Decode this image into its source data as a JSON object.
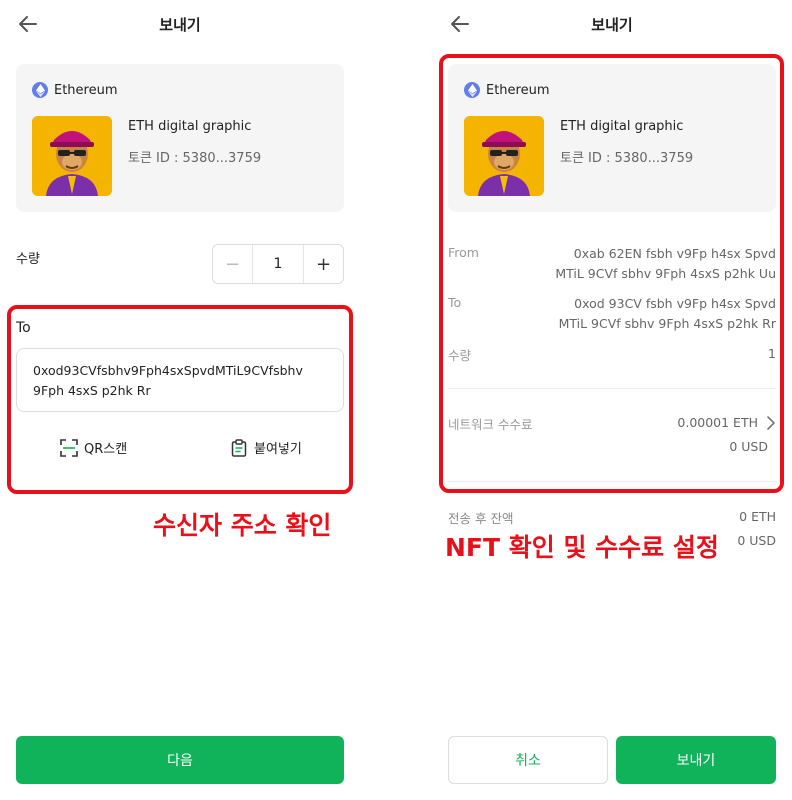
{
  "colors": {
    "accent": "#10b25a",
    "highlight": "#e8101a",
    "card_bg": "#f5f5f5",
    "eth": "#627eea"
  },
  "left": {
    "title": "보내기",
    "nft": {
      "chain": "Ethereum",
      "name": "ETH digital graphic",
      "token": "토큰 ID : 5380...3759"
    },
    "quantity": {
      "label": "수량",
      "value": "1",
      "minus": "−",
      "plus": "+"
    },
    "to": {
      "label": "To",
      "address_line1": "0xod93CVfsbhv9Fph4sxSpvdMTiL9CVfsbhv",
      "address_line2": "9Fph 4sxS p2hk Rr"
    },
    "actions": {
      "qr": "QR스캔",
      "paste": "붙여넣기"
    },
    "annotation": "수신자 주소 확인",
    "next_button": "다음"
  },
  "right": {
    "title": "보내기",
    "nft": {
      "chain": "Ethereum",
      "name": "ETH digital graphic",
      "token": "토큰 ID : 5380...3759"
    },
    "from": {
      "label": "From",
      "line1": "0xab 62EN fsbh v9Fp h4sx Spvd",
      "line2": "MTiL 9CVf sbhv 9Fph 4sxS p2hk Uu"
    },
    "to": {
      "label": "To",
      "line1": "0xod 93CV fsbh v9Fp h4sx Spvd",
      "line2": "MTiL 9CVf sbhv 9Fph 4sxS p2hk Rr"
    },
    "quantity": {
      "label": "수량",
      "value": "1"
    },
    "fee": {
      "label": "네트워크 수수료",
      "eth": "0.00001 ETH",
      "usd": "0 USD"
    },
    "balance": {
      "label": "전송 후 잔액",
      "eth": "0 ETH",
      "usd": "0 USD"
    },
    "annotation": "NFT 확인 및 수수료 설정",
    "cancel_button": "취소",
    "send_button": "보내기"
  }
}
